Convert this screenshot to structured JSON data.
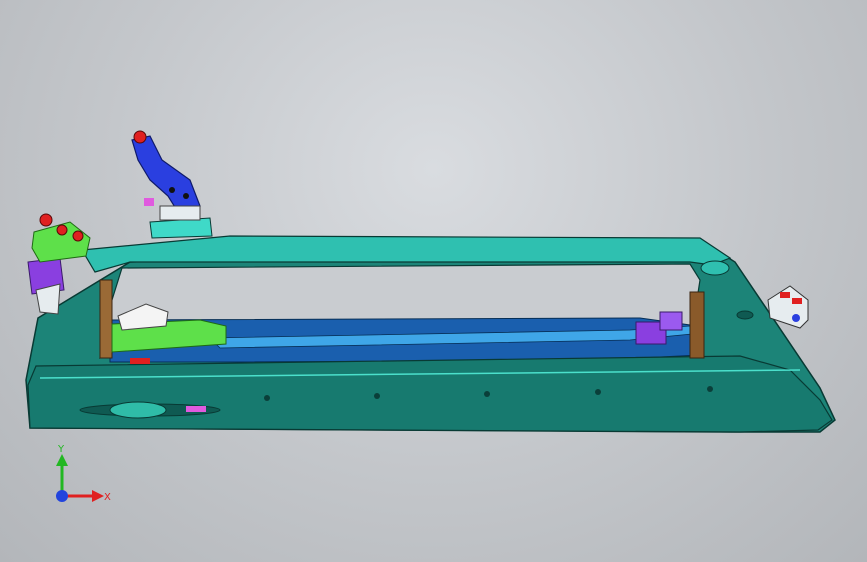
{
  "viewport": {
    "background_top": "#d9dce0",
    "background_bottom": "#b3b6ba"
  },
  "triad": {
    "x_label": "X",
    "y_label": "Y",
    "x_color": "#e02020",
    "y_color": "#22b722",
    "z_color": "#2244dd"
  },
  "model": {
    "body_color": "#1f8f86",
    "edge_color": "#0a3f3a",
    "highlight_color": "#3fd9c8",
    "blue_part_color": "#2a3fe0",
    "green_part_color": "#5ee04a",
    "purple_part_color": "#9b3fe0",
    "brown_part_color": "#8a5a2a",
    "red_marker_color": "#e02020"
  }
}
